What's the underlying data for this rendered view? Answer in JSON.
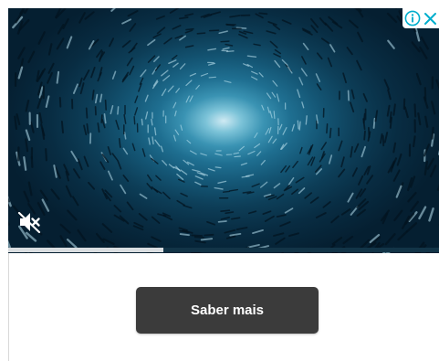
{
  "ad": {
    "cta_label": "Saber mais",
    "video": {
      "muted": true,
      "progress": 0.36
    },
    "icons": {
      "info": "info-icon",
      "close": "close-icon",
      "mute": "speaker-muted-icon"
    },
    "colors": {
      "adchoices_blue": "#00aecd",
      "button_bg": "#3b3b3b",
      "button_text": "#ffffff"
    }
  }
}
